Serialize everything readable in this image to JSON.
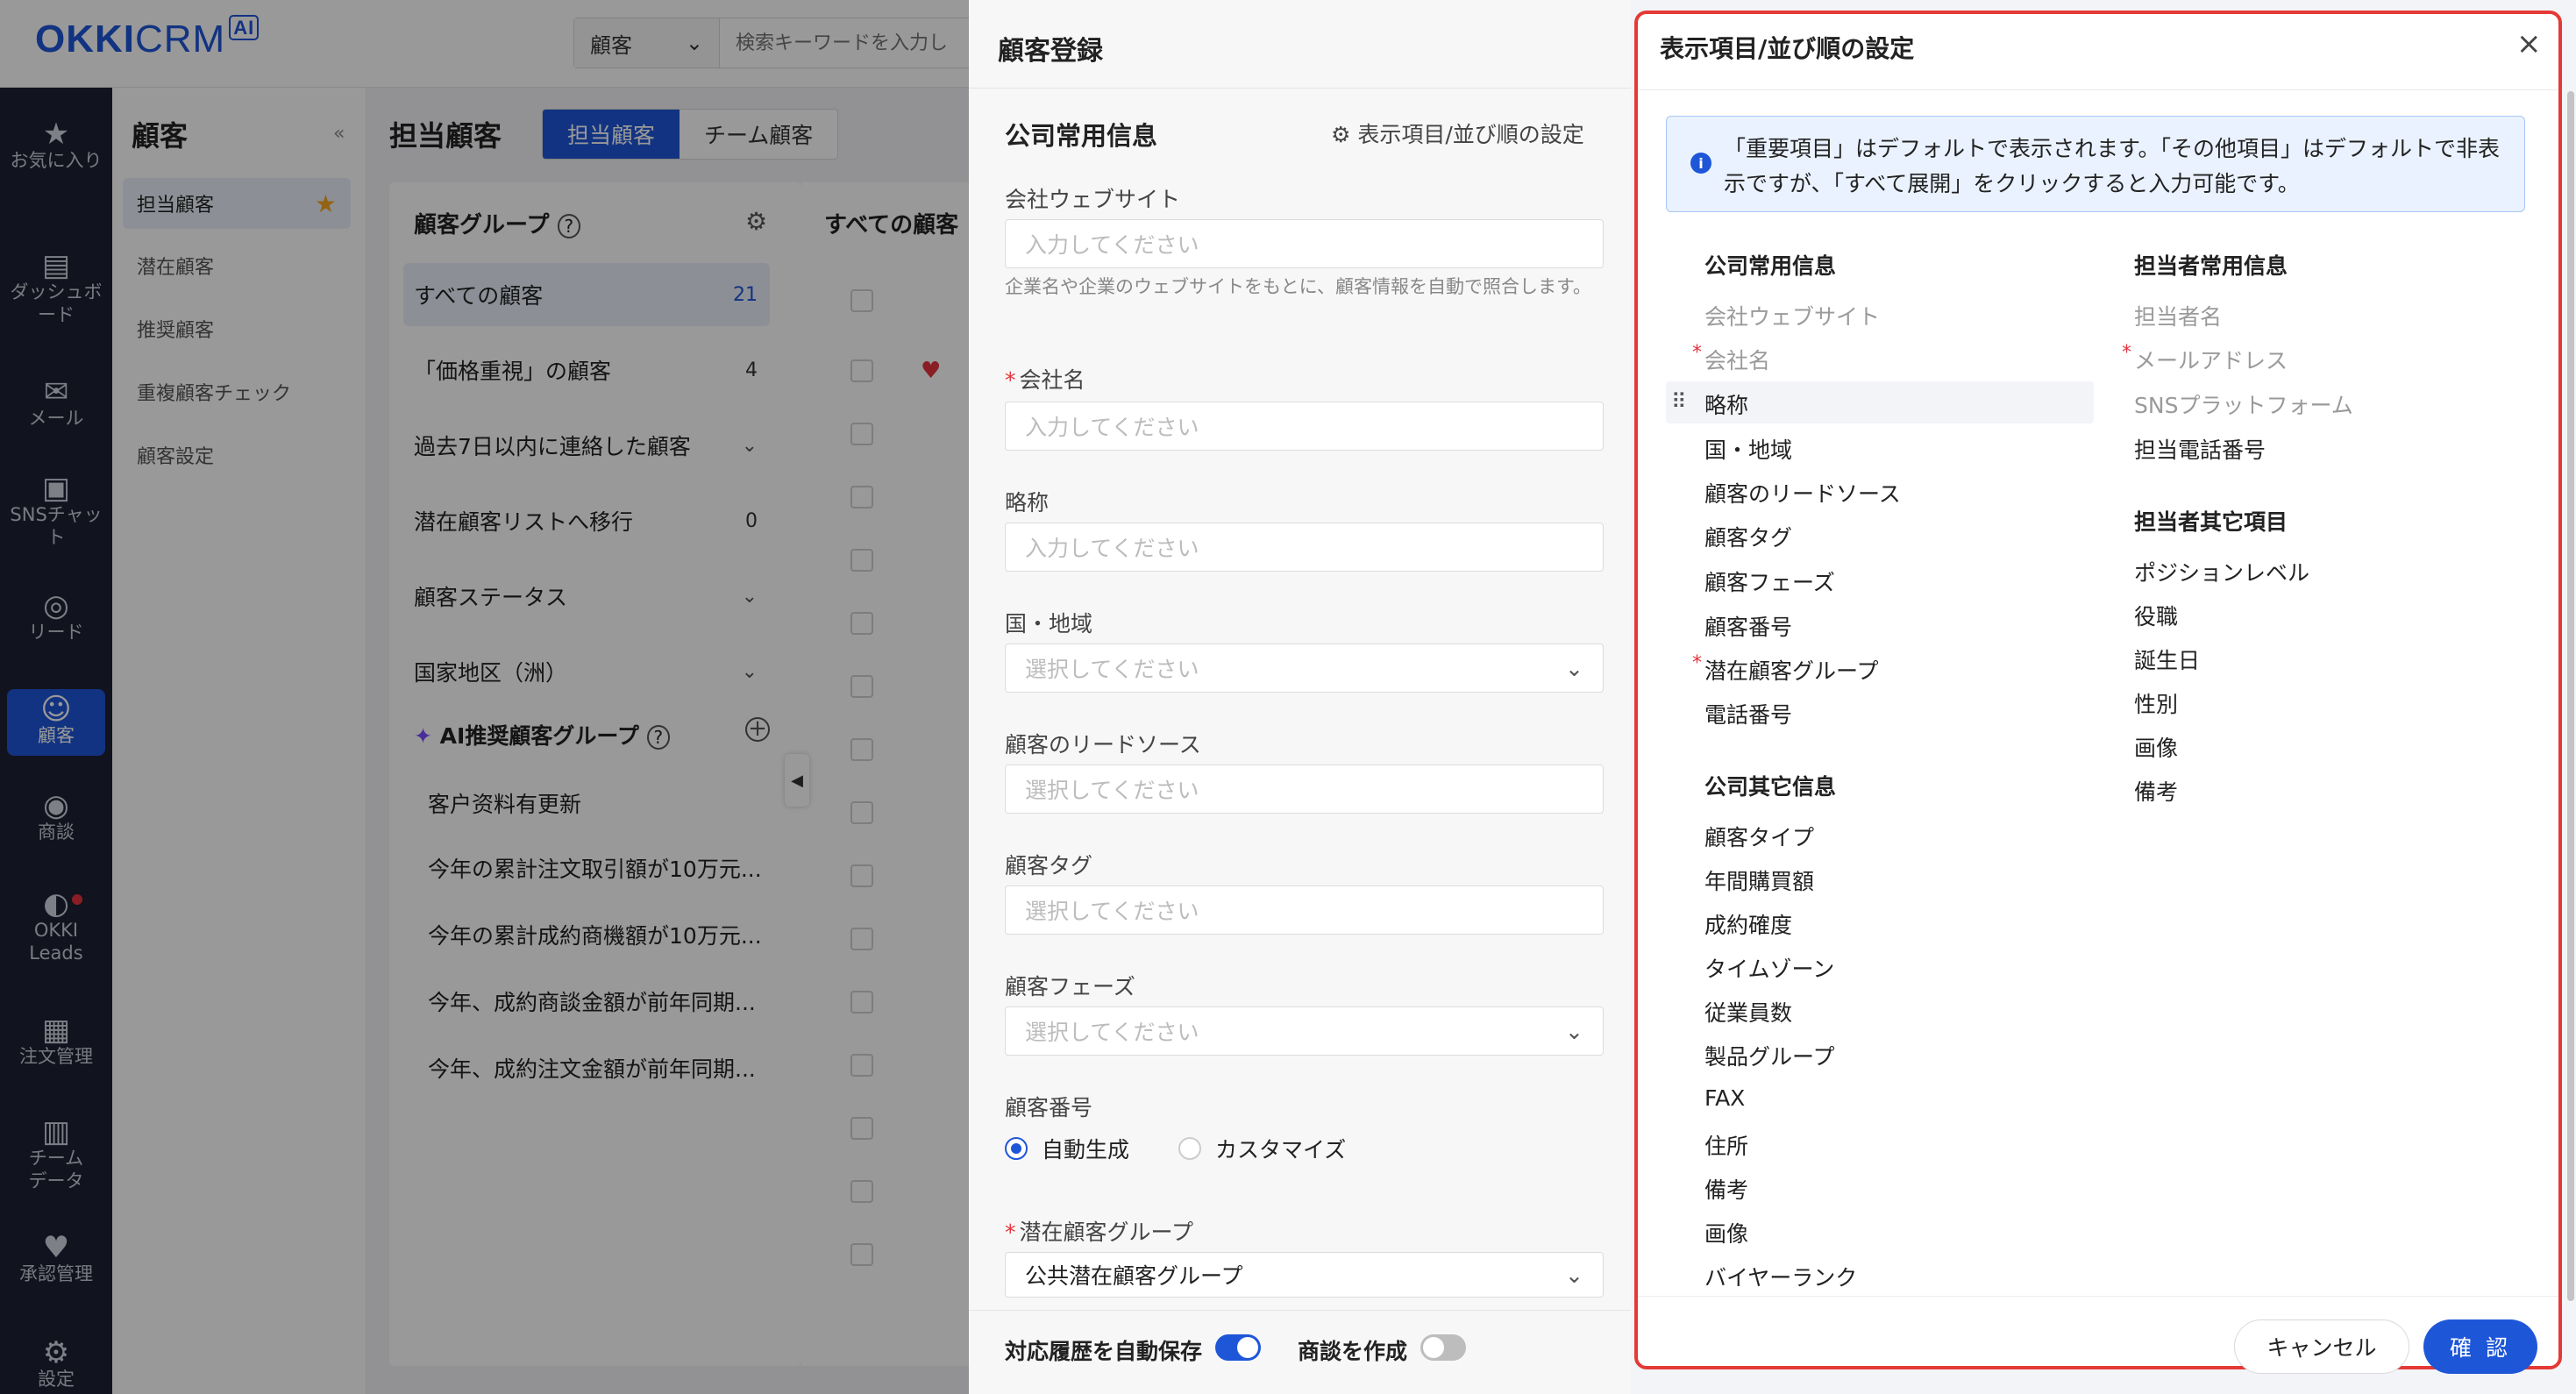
{
  "app": {
    "logo_main": "OKKI",
    "logo_crm": "CRM",
    "logo_ai": "AI"
  },
  "search": {
    "scope": "顧客",
    "placeholder": "検索キーワードを入力し"
  },
  "rail": [
    {
      "label": "お気に入り",
      "icon": "star-icon"
    },
    {
      "label": "ダッシュボード",
      "icon": "dashboard-icon"
    },
    {
      "label": "メール",
      "icon": "mail-icon"
    },
    {
      "label": "SNSチャット",
      "icon": "chat-icon"
    },
    {
      "label": "リード",
      "icon": "lead-icon"
    },
    {
      "label": "顧客",
      "icon": "customer-icon"
    },
    {
      "label": "商談",
      "icon": "target-icon"
    },
    {
      "label": "OKKI Leads",
      "icon": "leads-icon"
    },
    {
      "label": "注文管理",
      "icon": "order-icon"
    },
    {
      "label": "チームデータ",
      "icon": "chart-icon"
    },
    {
      "label": "承認管理",
      "icon": "approval-icon"
    },
    {
      "label": "設定",
      "icon": "settings-icon"
    }
  ],
  "sidebar": {
    "title": "顧客",
    "items": [
      "担当顧客",
      "潜在顧客",
      "推奨顧客",
      "重複顧客チェック",
      "顧客設定"
    ]
  },
  "main": {
    "title": "担当顧客",
    "tabs": [
      "担当顧客",
      "チーム顧客"
    ],
    "group_header": "顧客グループ",
    "groups": [
      {
        "label": "すべての顧客",
        "count": "21"
      },
      {
        "label": "「価格重視」の顧客",
        "count": "4"
      },
      {
        "label": "過去7日以内に連絡した顧客",
        "count": ""
      },
      {
        "label": "潜在顧客リストへ移行",
        "count": "0"
      },
      {
        "label": "顧客ステータス",
        "count": ""
      },
      {
        "label": "国家地区（洲）",
        "count": ""
      }
    ],
    "ai_header": "AI推奨顧客グループ",
    "ai_groups": [
      "客户资料有更新",
      "今年の累計注文取引額が10万元...",
      "今年の累計成約商機額が10万元...",
      "今年、成約商談金額が前年同期...",
      "今年、成約注文金額が前年同期..."
    ],
    "table_header": "すべての顧客"
  },
  "registration": {
    "title": "顧客登録",
    "section": "公司常用信息",
    "settings_link": "表示項目/並び順の設定",
    "placeholder_input": "入力してください",
    "placeholder_select": "選択してください",
    "website_label": "会社ウェブサイト",
    "website_hint": "企業名や企業のウェブサイトをもとに、顧客情報を自動で照合します。",
    "company_label": "会社名",
    "short_label": "略称",
    "country_label": "国・地域",
    "source_label": "顧客のリードソース",
    "tag_label": "顧客タグ",
    "phase_label": "顧客フェーズ",
    "number_label": "顧客番号",
    "radio_auto": "自動生成",
    "radio_custom": "カスタマイズ",
    "pool_label": "潜在顧客グループ",
    "pool_value": "公共潜在顧客グループ",
    "autosave_label": "対応履歴を自動保存",
    "autosave_on": true,
    "create_deal_label": "商談を作成",
    "create_deal_on": false
  },
  "dialog": {
    "title": "表示項目/並び順の設定",
    "info": "「重要項目」はデフォルトで表示されます。「その他項目」はデフォルトで非表示ですが、「すべて展開」をクリックすると入力可能です。",
    "col1_header": "公司常用信息",
    "col1_items": [
      {
        "label": "会社ウェブサイト",
        "required": false,
        "dim": true
      },
      {
        "label": "会社名",
        "required": true,
        "dim": true
      },
      {
        "label": "略称",
        "required": false,
        "dim": false
      },
      {
        "label": "国・地域",
        "required": false,
        "dim": false
      },
      {
        "label": "顧客のリードソース",
        "required": false,
        "dim": false
      },
      {
        "label": "顧客タグ",
        "required": false,
        "dim": false
      },
      {
        "label": "顧客フェーズ",
        "required": false,
        "dim": false
      },
      {
        "label": "顧客番号",
        "required": false,
        "dim": false
      },
      {
        "label": "潜在顧客グループ",
        "required": true,
        "dim": false
      },
      {
        "label": "電話番号",
        "required": false,
        "dim": false
      }
    ],
    "col1b_header": "公司其它信息",
    "col1b_items": [
      "顧客タイプ",
      "年間購買額",
      "成約確度",
      "タイムゾーン",
      "従業員数",
      "製品グループ",
      "FAX",
      "住所",
      "備考",
      "画像",
      "バイヤーランク"
    ],
    "col2_header": "担当者常用信息",
    "col2_items": [
      {
        "label": "担当者名",
        "required": false,
        "dim": true
      },
      {
        "label": "メールアドレス",
        "required": true,
        "dim": true
      },
      {
        "label": "SNSプラットフォーム",
        "required": false,
        "dim": true
      },
      {
        "label": "担当電話番号",
        "required": false,
        "dim": false
      }
    ],
    "col2b_header": "担当者其它項目",
    "col2b_items": [
      "ポジションレベル",
      "役職",
      "誕生日",
      "性別",
      "画像",
      "備考"
    ],
    "cancel": "キャンセル",
    "confirm": "確 認"
  }
}
